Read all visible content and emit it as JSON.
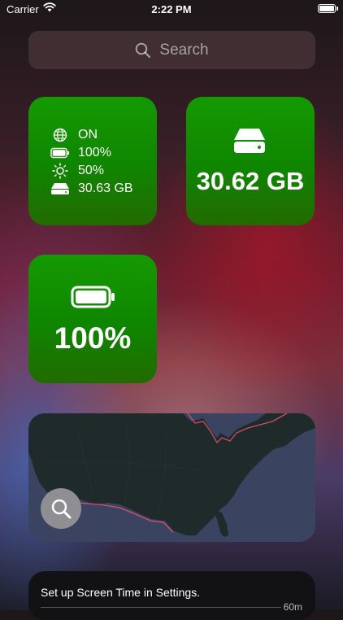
{
  "status": {
    "carrier": "Carrier",
    "time": "2:22 PM"
  },
  "search": {
    "placeholder": "Search"
  },
  "info_widget": {
    "rows": [
      {
        "icon": "globe-icon",
        "value": "ON"
      },
      {
        "icon": "battery-icon",
        "value": "100%"
      },
      {
        "icon": "brightness-icon",
        "value": "50%"
      },
      {
        "icon": "drive-icon",
        "value": "30.63 GB"
      }
    ]
  },
  "storage_widget": {
    "icon": "drive-icon",
    "value": "30.62 GB"
  },
  "battery_widget": {
    "icon": "battery-icon",
    "value": "100%",
    "level": 1.0
  },
  "map_widget": {
    "button_icon": "magnifier-icon"
  },
  "screen_time": {
    "message": "Set up Screen Time in Settings.",
    "axis_label": "60m"
  },
  "colors": {
    "widget_green": "#139200",
    "search_bg": "#50393f",
    "map_water": "#3a4460",
    "map_land": "#1f2a2b"
  }
}
